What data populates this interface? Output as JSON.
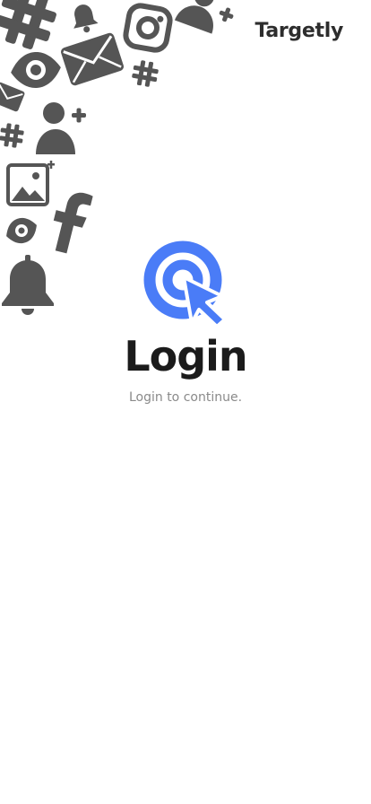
{
  "header": {
    "brand": "Targetly"
  },
  "main": {
    "title": "Login",
    "subtitle": "Login to continue."
  },
  "colors": {
    "accent": "#4a7cf7",
    "icon_gray": "#555555",
    "title": "#1b1b1b",
    "subtitle": "#8a8a8a"
  },
  "decorative_icons": [
    "hashtag-icon",
    "bell-icon",
    "instagram-icon",
    "add-user-icon",
    "eye-icon",
    "mail-icon",
    "hashtag-icon",
    "mail-icon",
    "add-user-icon",
    "hashtag-icon",
    "add-image-icon",
    "facebook-icon",
    "eye-icon",
    "bell-icon"
  ]
}
